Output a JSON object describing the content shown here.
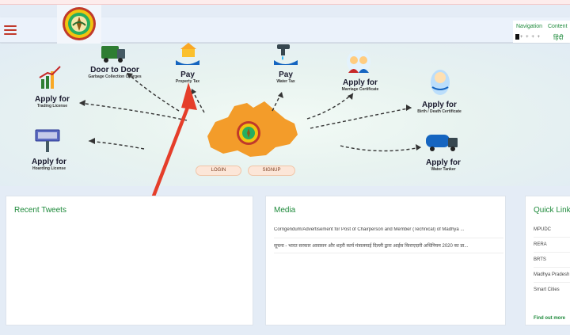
{
  "header": {
    "nav_label": "Navigation",
    "content_label": "Content",
    "language": "हिंदी",
    "accent_color": "#1e8a3b",
    "menu_color": "#c0392b"
  },
  "hero": {
    "services": [
      {
        "key": "door",
        "line1": "Door to Door",
        "line2": "Garbage Collection Charges",
        "icon": "garbage-truck-icon"
      },
      {
        "key": "property",
        "line1": "Pay",
        "line2": "Property Tax",
        "icon": "house-hand-icon"
      },
      {
        "key": "water",
        "line1": "Pay",
        "line2": "Water Tax",
        "icon": "water-tap-icon"
      },
      {
        "key": "marriage",
        "line1": "Apply for",
        "line2": "Marriage Certificate",
        "icon": "couple-icon"
      },
      {
        "key": "trading",
        "line1": "Apply for",
        "line2": "Trading License",
        "icon": "growth-chart-icon"
      },
      {
        "key": "birth",
        "line1": "Apply for",
        "line2": "Birth / Death Certificate",
        "icon": "baby-icon"
      },
      {
        "key": "hoarding",
        "line1": "Apply for",
        "line2": "Hoarding License",
        "icon": "billboard-icon"
      },
      {
        "key": "tanker",
        "line1": "Apply for",
        "line2": "Water Tanker",
        "icon": "water-tanker-icon"
      }
    ],
    "login": "LOGIN",
    "signup": "SIGNUP",
    "map_color": "#f39c2a",
    "highlight_color": "#e53e2a"
  },
  "cards": {
    "tweets": {
      "title": "Recent Tweets"
    },
    "media": {
      "title": "Media",
      "items": [
        "Corrigendum/Advertisement for Post of Chairperson and Member (Technical) of Madhya ...",
        "सूचना - भारत सरकार आवासन और शहरी कार्य मंत्रालयाई दिल्ली द्वारा आईस किराएदारी अधिनियम 2020 का प्रा..."
      ]
    },
    "quick": {
      "title": "Quick Links",
      "items": [
        "MPUDC",
        "RERA",
        "BRTS",
        "Madhya Pradesh",
        "Smart Cities"
      ],
      "find_more": "Find out more"
    }
  }
}
